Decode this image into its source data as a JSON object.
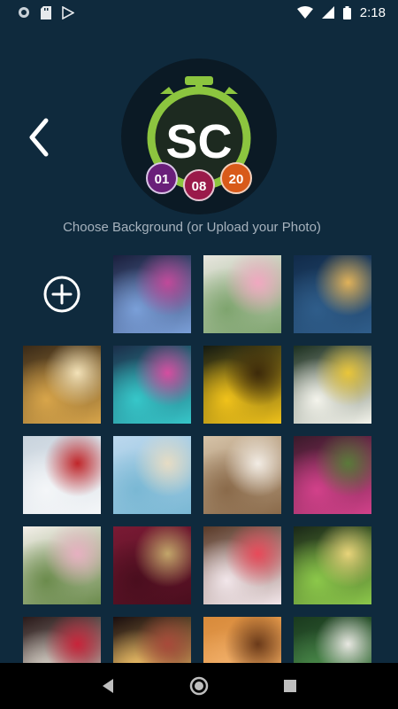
{
  "status_bar": {
    "time": "2:18",
    "icons": [
      "notification-dot-icon",
      "sd-card-icon",
      "play-store-icon",
      "wifi-icon",
      "signal-icon",
      "battery-icon"
    ]
  },
  "header": {
    "back_icon": "chevron-left-icon",
    "logo": {
      "initials": "SC",
      "counter_1": "01",
      "counter_2": "08",
      "counter_3": "20"
    }
  },
  "subtitle": "Choose Background (or Upload your Photo)",
  "gallery": {
    "upload_icon": "plus-circle-icon",
    "tiles": [
      {
        "subject": "confetti-concert",
        "colors": [
          "#1a1f3d",
          "#7a9fd8",
          "#c04a9a"
        ]
      },
      {
        "subject": "wedding-hands",
        "colors": [
          "#e8e6df",
          "#7ea46e",
          "#f0a8c0"
        ]
      },
      {
        "subject": "champagne-toast",
        "colors": [
          "#112b4a",
          "#2f5d8a",
          "#e0b25a"
        ]
      },
      {
        "subject": "party-people",
        "colors": [
          "#3a2a18",
          "#d8a54a",
          "#f3e2b8"
        ]
      },
      {
        "subject": "neon-lights",
        "colors": [
          "#1b2f4a",
          "#36c7c9",
          "#d54ea0"
        ]
      },
      {
        "subject": "sunflowers",
        "colors": [
          "#141a12",
          "#f0c21a",
          "#3d2a0a"
        ]
      },
      {
        "subject": "daisies",
        "colors": [
          "#1c3020",
          "#f4f4ec",
          "#e9c63a"
        ]
      },
      {
        "subject": "mountain-hiker",
        "colors": [
          "#c8d3dd",
          "#f4f6f8",
          "#c0262a"
        ]
      },
      {
        "subject": "beach-chairs",
        "colors": [
          "#bcd8ee",
          "#7ab8d4",
          "#e6dcc4"
        ]
      },
      {
        "subject": "wedding-sign",
        "colors": [
          "#d6c3a8",
          "#8a6a4a",
          "#f2ece4"
        ]
      },
      {
        "subject": "pink-blossoms",
        "colors": [
          "#3a1a2a",
          "#d2418a",
          "#5a7a3a"
        ]
      },
      {
        "subject": "wedding-aisle",
        "colors": [
          "#f3efe9",
          "#6b8b4c",
          "#e6b0c0"
        ]
      },
      {
        "subject": "graduation",
        "colors": [
          "#7a1a34",
          "#4a0e1e",
          "#c2a66a"
        ]
      },
      {
        "subject": "cupcake",
        "colors": [
          "#5a3a28",
          "#f2e6ea",
          "#e84a5a"
        ]
      },
      {
        "subject": "cocktail",
        "colors": [
          "#1a2818",
          "#8cc84a",
          "#e8d47a"
        ]
      },
      {
        "subject": "christmas-cake",
        "colors": [
          "#2a1a1a",
          "#d8d2c8",
          "#c8243a"
        ]
      },
      {
        "subject": "sparkler",
        "colors": [
          "#1a0e0e",
          "#f6c66a",
          "#a84a3a"
        ]
      },
      {
        "subject": "heart-hands",
        "colors": [
          "#d88a3a",
          "#f2b06a",
          "#6a3a1a"
        ]
      },
      {
        "subject": "zen-stones",
        "colors": [
          "#1a3a1e",
          "#4a8a4a",
          "#e8e8e2"
        ]
      }
    ]
  },
  "nav_bar": {
    "back_icon": "triangle-back-icon",
    "home_icon": "circle-home-icon",
    "recents_icon": "square-recents-icon"
  }
}
